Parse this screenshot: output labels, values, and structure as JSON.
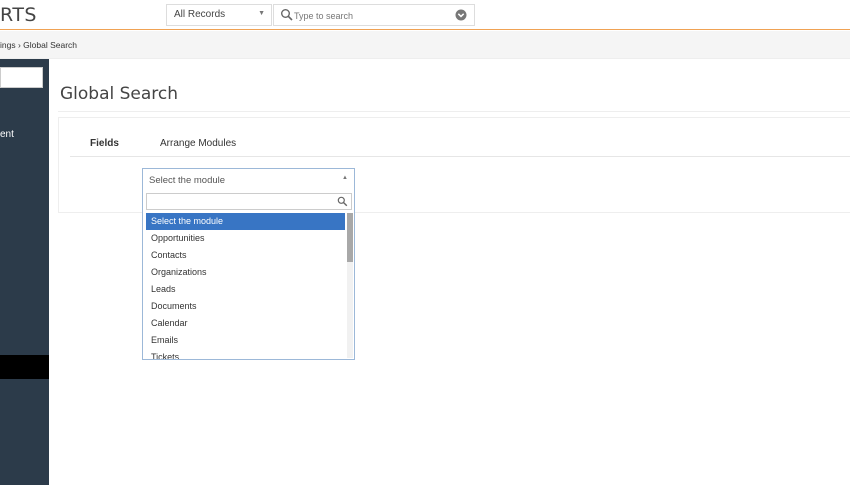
{
  "app": {
    "logo_text": "RTS"
  },
  "topbar": {
    "records_filter": "All Records",
    "search_placeholder": "Type to search"
  },
  "breadcrumb": {
    "text": "ings › Global Search"
  },
  "sidebar": {
    "item_label": "ent"
  },
  "page": {
    "title": "Global Search",
    "tabs": [
      {
        "label": "Fields"
      },
      {
        "label": "Arrange Modules"
      }
    ]
  },
  "module_select": {
    "selected": "Select the module",
    "options": [
      "Select the module",
      "Opportunities",
      "Contacts",
      "Organizations",
      "Leads",
      "Documents",
      "Calendar",
      "Emails",
      "Tickets"
    ]
  },
  "colors": {
    "accent": "#f0a253",
    "sidebar": "#2c3b4a",
    "highlight": "#3875c4"
  }
}
